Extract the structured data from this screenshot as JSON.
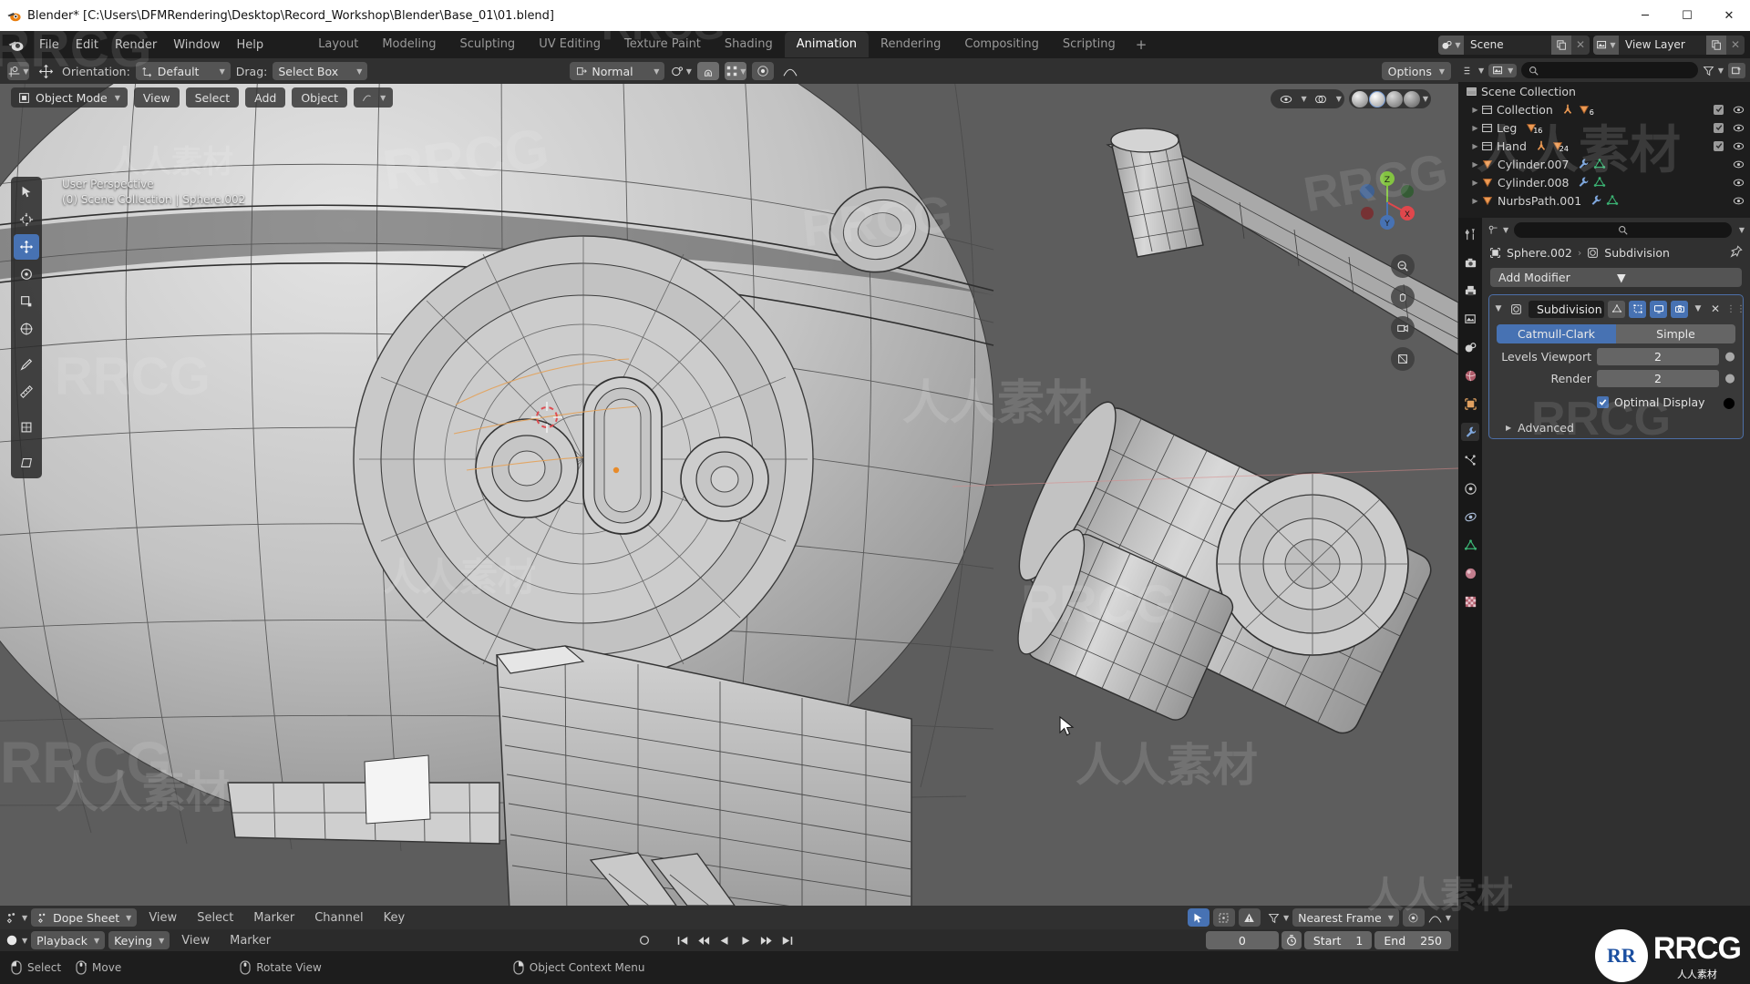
{
  "window": {
    "title": "Blender* [C:\\Users\\DFMRendering\\Desktop\\Record_Workshop\\Blender\\Base_01\\01.blend]",
    "minimize": "─",
    "maximize": "☐",
    "close": "✕"
  },
  "topbar": {
    "menus": [
      "File",
      "Edit",
      "Render",
      "Window",
      "Help"
    ],
    "workspaces": [
      {
        "label": "Layout",
        "active": false
      },
      {
        "label": "Modeling",
        "active": false
      },
      {
        "label": "Sculpting",
        "active": false
      },
      {
        "label": "UV Editing",
        "active": false
      },
      {
        "label": "Texture Paint",
        "active": false
      },
      {
        "label": "Shading",
        "active": false
      },
      {
        "label": "Animation",
        "active": true
      },
      {
        "label": "Rendering",
        "active": false
      },
      {
        "label": "Compositing",
        "active": false
      },
      {
        "label": "Scripting",
        "active": false
      }
    ],
    "add_workspace": "+",
    "scene_name": "Scene",
    "view_layer_name": "View Layer"
  },
  "tool_settings": {
    "orientation_label": "Orientation:",
    "orientation_value": "Default",
    "drag_label": "Drag:",
    "drag_value": "Select Box",
    "transform_value": "Normal",
    "options_label": "Options"
  },
  "viewport": {
    "mode": "Object Mode",
    "menus": [
      "View",
      "Select",
      "Add",
      "Object"
    ],
    "overlay_line1": "User Perspective",
    "overlay_line2": "(0) Scene Collection | Sphere.002",
    "gizmo_axes": [
      "X",
      "Y",
      "Z"
    ],
    "background_color": "#5d5d5d",
    "mesh_color": "#b9b9b9"
  },
  "outliner": {
    "search_placeholder": "",
    "root": "Scene Collection",
    "rows": [
      {
        "name": "Collection",
        "indent": 1,
        "type": "collection",
        "badges": [
          "armature",
          "mesh"
        ],
        "badge_count": "6",
        "checkbox": true,
        "eye": true
      },
      {
        "name": "Leg",
        "indent": 1,
        "type": "collection",
        "badges": [
          "mesh"
        ],
        "badge_count": "16",
        "checkbox": true,
        "eye": true
      },
      {
        "name": "Hand",
        "indent": 1,
        "type": "collection",
        "badges": [
          "armature",
          "mesh"
        ],
        "badge_count": "24",
        "checkbox": true,
        "eye": true
      },
      {
        "name": "Cylinder.007",
        "indent": 1,
        "type": "mesh",
        "badges": [
          "modifier",
          "data"
        ],
        "badge_count": "",
        "checkbox": false,
        "eye": true
      },
      {
        "name": "Cylinder.008",
        "indent": 1,
        "type": "mesh",
        "badges": [
          "modifier",
          "data"
        ],
        "badge_count": "",
        "checkbox": false,
        "eye": true
      },
      {
        "name": "NurbsPath.001",
        "indent": 1,
        "type": "mesh",
        "badges": [
          "modifier",
          "data"
        ],
        "badge_count": "",
        "checkbox": false,
        "eye": true
      }
    ]
  },
  "properties": {
    "breadcrumb_object": "Sphere.002",
    "breadcrumb_modifier": "Subdivision",
    "add_modifier": "Add Modifier",
    "modifier": {
      "name": "Subdivision",
      "type_catmull": "Catmull-Clark",
      "type_simple": "Simple",
      "type_selected": "Catmull-Clark",
      "levels_viewport_label": "Levels Viewport",
      "levels_viewport_value": "2",
      "render_label": "Render",
      "render_value": "2",
      "optimal_display_label": "Optimal Display",
      "optimal_display_checked": true,
      "advanced_label": "Advanced"
    },
    "tabs": [
      "tool-icon",
      "render-icon",
      "output-icon",
      "view-layer-icon",
      "scene-icon",
      "world-icon",
      "object-icon",
      "modifier-icon",
      "particles-icon",
      "physics-icon",
      "constraint-icon",
      "data-icon",
      "material-icon",
      "texture-icon"
    ],
    "active_tab": "modifier-icon"
  },
  "dope_sheet": {
    "editor_name": "Dope Sheet",
    "menus": [
      "View",
      "Select",
      "Marker",
      "Channel",
      "Key"
    ],
    "snap_mode": "Nearest Frame",
    "playback_label": "Playback",
    "keying_label": "Keying",
    "timeline_menus": [
      "View",
      "Marker"
    ],
    "current_frame": "0",
    "start_label": "Start",
    "start_value": "1",
    "end_label": "End",
    "end_value": "250"
  },
  "statusbar": {
    "items": [
      {
        "icon": "mouse-left-icon",
        "label": "Select"
      },
      {
        "icon": "mouse-middle-icon",
        "label": "Move"
      },
      {
        "icon": "mouse-middle-icon",
        "label": "Rotate View"
      },
      {
        "icon": "mouse-right-icon",
        "label": "Object Context Menu"
      }
    ]
  },
  "branding": {
    "logo_text": "RR",
    "name": "RRCG",
    "subtitle": "人人素材"
  },
  "watermarks": {
    "latin": "RRCG",
    "cjk": "人人素材"
  },
  "colors": {
    "accent_blue": "#4772b3",
    "panel_bg": "#303030",
    "dark_bg": "#1d1d1d",
    "viewport_bg": "#5d5d5d",
    "orange": "#ed9a53",
    "green": "#3bb273"
  }
}
